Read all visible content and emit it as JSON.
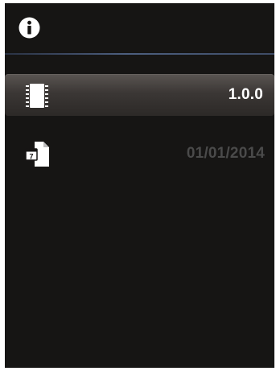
{
  "header": {
    "icon": "info-icon"
  },
  "items": [
    {
      "icon": "chip-icon",
      "value": "1.0.0",
      "selected": true
    },
    {
      "icon": "calendar-file-icon",
      "calendar_day": "7",
      "value": "01/01/2014",
      "selected": false
    }
  ],
  "colors": {
    "background": "#161514",
    "divider": "#4d5f7f",
    "selected_row": "#3b3735",
    "value_active": "#ffffff",
    "value_inactive": "#4a4a4a"
  }
}
